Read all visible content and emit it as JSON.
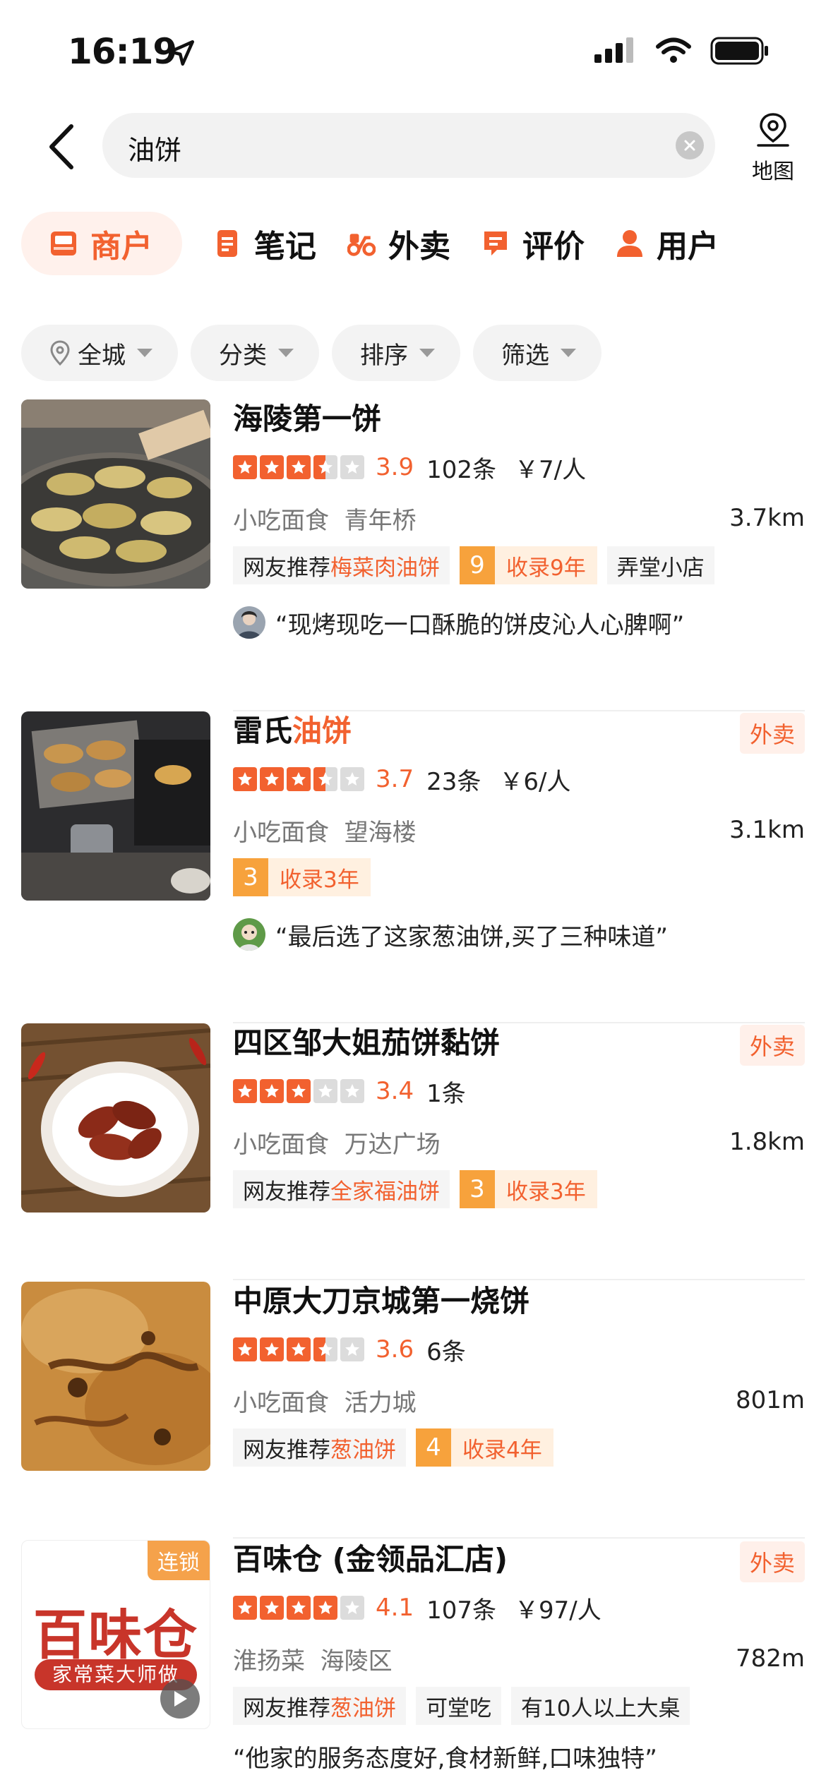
{
  "status": {
    "time": "16:19"
  },
  "search": {
    "query": "油饼",
    "map_label": "地图"
  },
  "tabs": [
    {
      "label": "商户",
      "icon": "storefront-icon"
    },
    {
      "label": "笔记",
      "icon": "note-icon"
    },
    {
      "label": "外卖",
      "icon": "scooter-icon"
    },
    {
      "label": "评价",
      "icon": "comment-icon"
    },
    {
      "label": "用户",
      "icon": "user-icon"
    }
  ],
  "filters": [
    {
      "label": "全城"
    },
    {
      "label": "分类"
    },
    {
      "label": "排序"
    },
    {
      "label": "筛选"
    }
  ],
  "colors": {
    "accent": "#f2612f",
    "star_active": "#f2612f",
    "star_inactive": "#dcdcdc"
  },
  "listings": [
    {
      "name_pre": "海陵第一饼",
      "name_hl": "",
      "waimai": "",
      "rating": 3.5,
      "score": "3.9",
      "reviews": "102条",
      "price": "￥7/人",
      "category": "小吃面食",
      "area": "青年桥",
      "distance": "3.7km",
      "recommend_prefix": "网友推荐",
      "recommend_dish": "梅菜肉油饼",
      "year_num": "9",
      "year_label": "收录9年",
      "extra_tags": [
        "弄堂小店"
      ],
      "quote": "“现烤现吃一口酥脆的饼皮沁人心脾啊”"
    },
    {
      "name_pre": "雷氏",
      "name_hl": "油饼",
      "waimai": "外卖",
      "rating": 3.5,
      "score": "3.7",
      "reviews": "23条",
      "price": "￥6/人",
      "category": "小吃面食",
      "area": "望海楼",
      "distance": "3.1km",
      "recommend_prefix": "",
      "recommend_dish": "",
      "year_num": "3",
      "year_label": "收录3年",
      "extra_tags": [],
      "quote": "“最后选了这家葱油饼,买了三种味道”"
    },
    {
      "name_pre": "四区邹大姐茄饼黏饼",
      "name_hl": "",
      "waimai": "外卖",
      "rating": 3,
      "score": "3.4",
      "reviews": "1条",
      "price": "",
      "category": "小吃面食",
      "area": "万达广场",
      "distance": "1.8km",
      "recommend_prefix": "网友推荐",
      "recommend_dish": "全家福油饼",
      "year_num": "3",
      "year_label": "收录3年",
      "extra_tags": [],
      "quote": ""
    },
    {
      "name_pre": "中原大刀京城第一烧饼",
      "name_hl": "",
      "waimai": "",
      "rating": 3.5,
      "score": "3.6",
      "reviews": "6条",
      "price": "",
      "category": "小吃面食",
      "area": "活力城",
      "distance": "801m",
      "recommend_prefix": "网友推荐",
      "recommend_dish": "葱油饼",
      "year_num": "4",
      "year_label": "收录4年",
      "extra_tags": [],
      "quote": ""
    },
    {
      "name_pre": "百味仓 (金领品汇店)",
      "name_hl": "",
      "waimai": "外卖",
      "rating": 4,
      "score": "4.1",
      "reviews": "107条",
      "price": "￥97/人",
      "category": "淮扬菜",
      "area": "海陵区",
      "distance": "782m",
      "recommend_prefix": "网友推荐",
      "recommend_dish": "葱油饼",
      "year_num": "",
      "year_label": "",
      "extra_tags": [
        "可堂吃",
        "有10人以上大桌"
      ],
      "quote": "“他家的服务态度好,食材新鲜,口味独特”",
      "chain_badge": "连锁",
      "logo_text": "百味仓",
      "logo_sub": "家常菜大师做"
    }
  ]
}
